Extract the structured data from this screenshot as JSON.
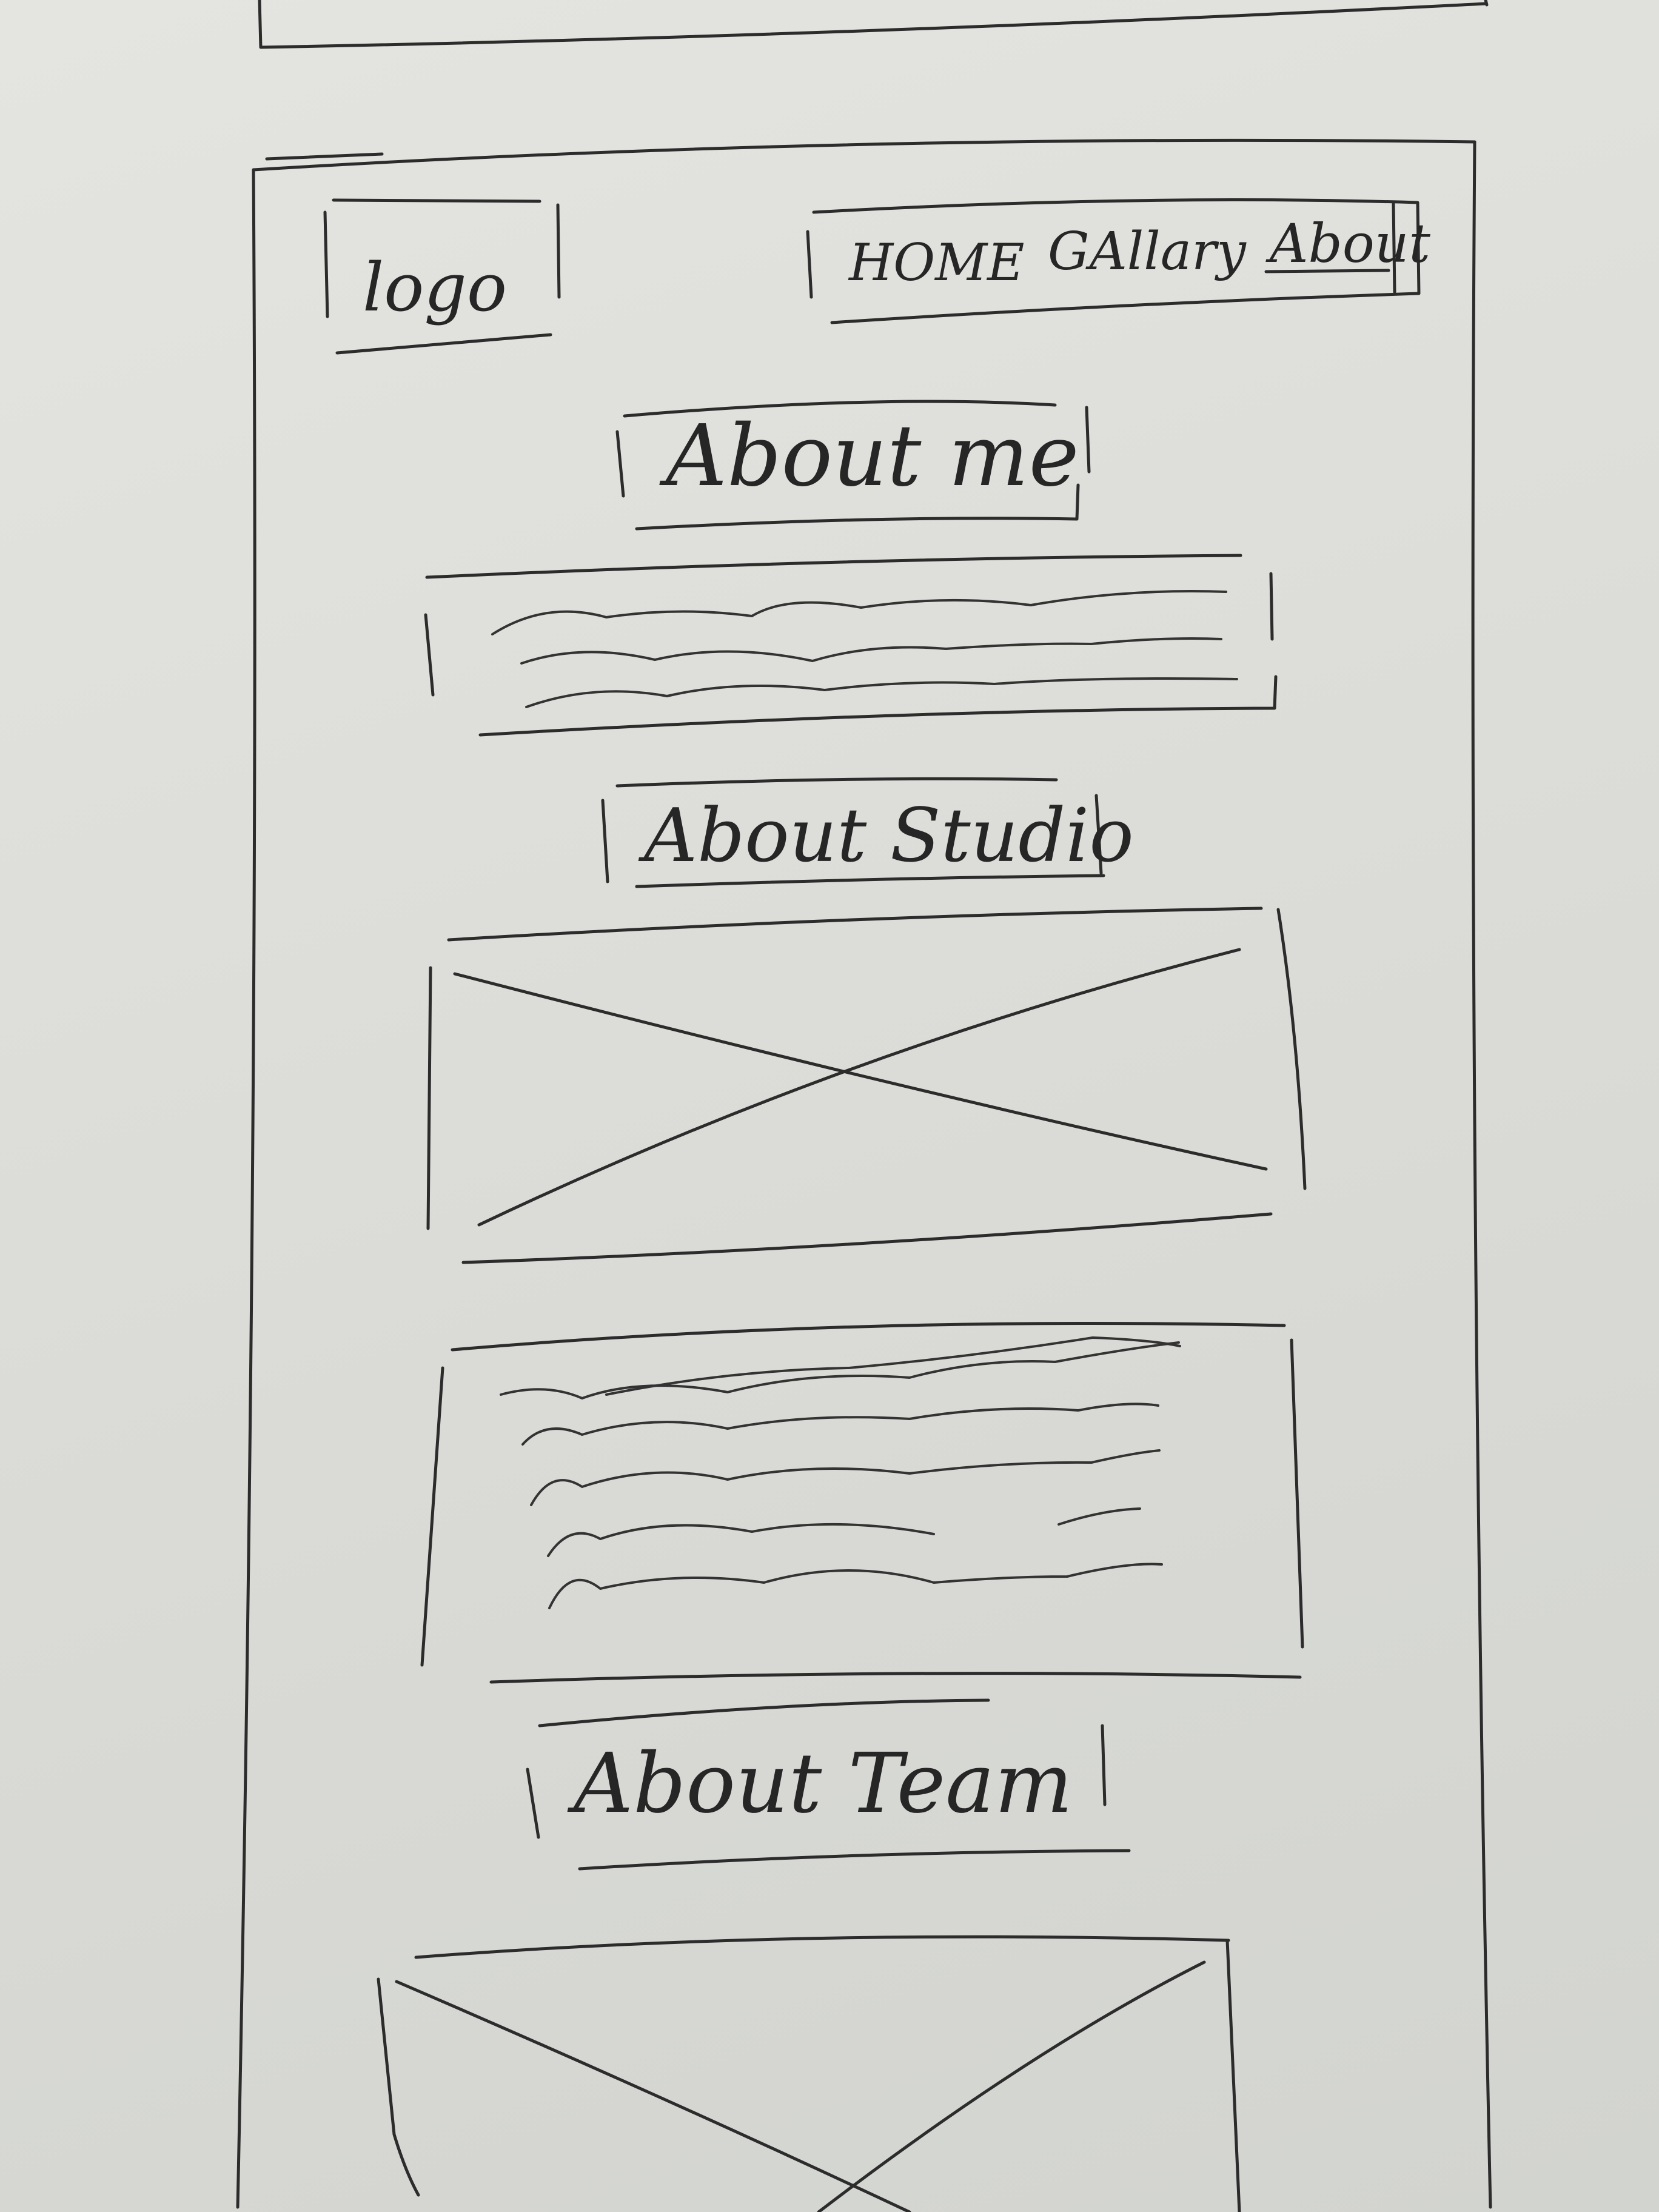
{
  "header": {
    "logo_label": "logo",
    "nav_home": "HOME",
    "nav_gallery": "GAllary",
    "nav_about": "About"
  },
  "sections": {
    "about_me_title": "About me",
    "about_studio_title": "About Studio",
    "about_team_title": "About Team"
  },
  "palette": {
    "paper": "#dededa",
    "ink": "#2c2c2c"
  }
}
